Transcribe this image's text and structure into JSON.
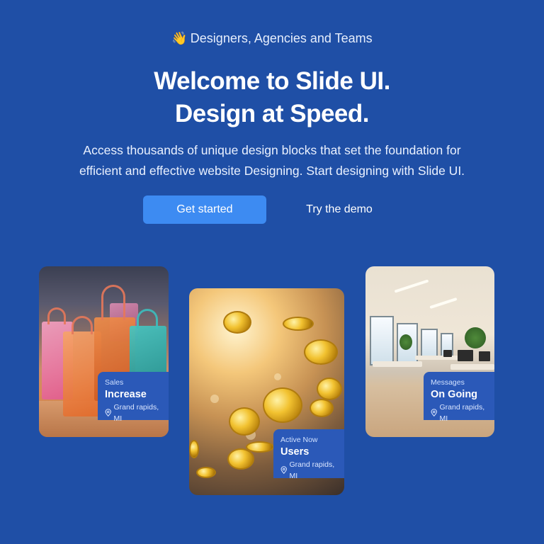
{
  "hero": {
    "tagline_emoji": "👋",
    "tagline": "Designers, Agencies and Teams",
    "title_line1": "Welcome to Slide UI.",
    "title_line2": "Design at Speed.",
    "subtitle_line1": "Access thousands of unique design blocks that set the foundation for",
    "subtitle_line2": "efficient and effective website Designing. Start designing with Slide UI.",
    "primary_button": "Get started",
    "secondary_button": "Try the demo"
  },
  "cards": [
    {
      "category": "Sales",
      "title": "Increase",
      "location": "Grand rapids, MI",
      "icon": "location-pin-icon",
      "image": "shopping-bags"
    },
    {
      "category": "Active Now",
      "title": "Users",
      "location": "Grand rapids, MI",
      "icon": "location-pin-icon",
      "image": "gold-coins"
    },
    {
      "category": "Messages",
      "title": "On Going",
      "location": "Grand rapids, MI",
      "icon": "location-pin-icon",
      "image": "office-interior"
    }
  ],
  "colors": {
    "background": "#1f4fa6",
    "primary_button": "#3d8bf2",
    "label_background": "#2b59b8"
  }
}
